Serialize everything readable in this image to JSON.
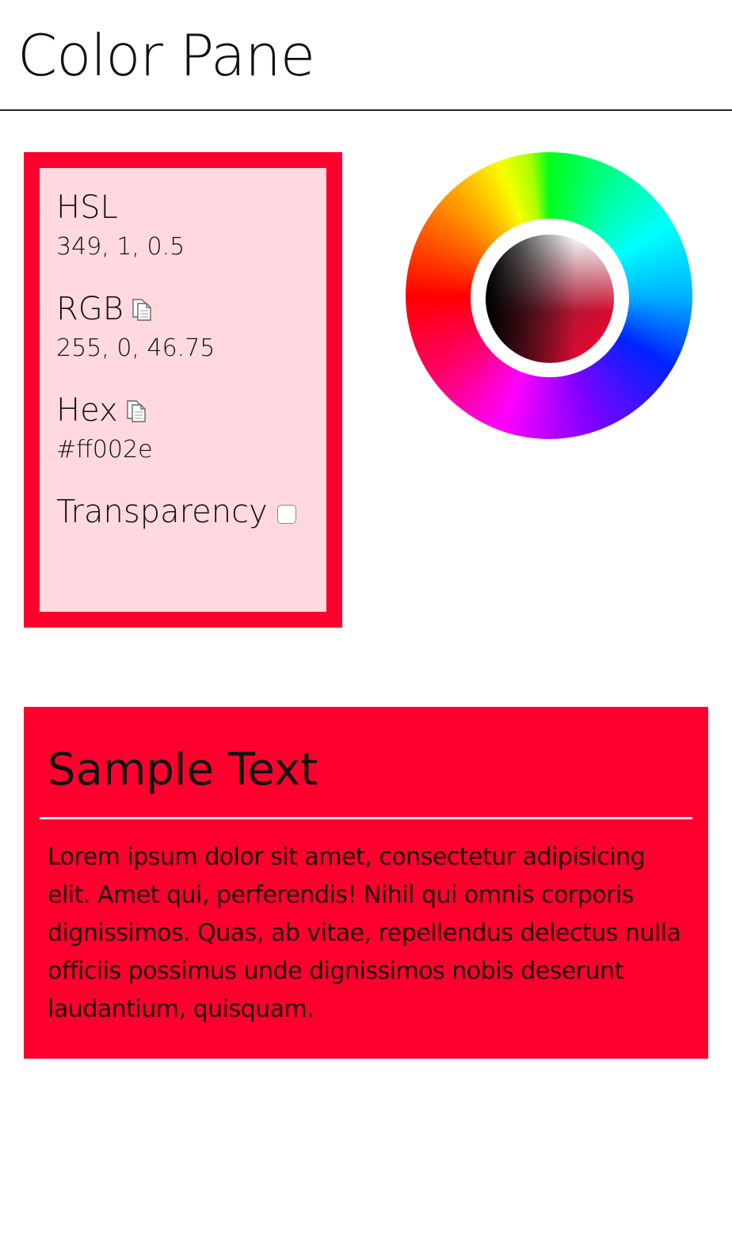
{
  "header": {
    "title": "Color Pane"
  },
  "info_panel": {
    "hsl": {
      "label": "HSL",
      "value": "349, 1, 0.5"
    },
    "rgb": {
      "label": "RGB",
      "value": "255, 0, 46.75",
      "icon": "copy-icon"
    },
    "hex": {
      "label": "Hex",
      "value": "#ff002e",
      "icon": "copy-icon"
    },
    "transparency": {
      "label": "Transparency",
      "checked": false
    }
  },
  "sample": {
    "heading": "Sample Text",
    "body": "Lorem ipsum dolor sit amet, consectetur adipisicing elit. Amet qui, perferendis! Nihil qui omnis corporis dignissimos. Quas, ab vitae, repellendus delectus nulla officiis possimus unde dignissimos nobis deserunt laudantium, quisquam."
  },
  "colors": {
    "selected": "#ff002e",
    "panel_background": "#ffd9df"
  }
}
